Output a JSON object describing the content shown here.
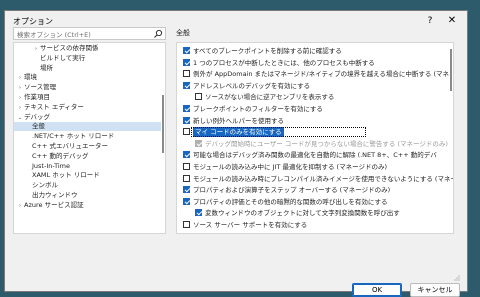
{
  "window": {
    "title": "オプション",
    "help_glyph": "?",
    "close_glyph": "✕"
  },
  "search": {
    "placeholder": "検索オプション (Ctrl+E)"
  },
  "tree": {
    "items": [
      {
        "label": "サービスの依存関係",
        "indent": 2,
        "chevron": "›"
      },
      {
        "label": "ビルドして実行",
        "indent": 2,
        "chevron": ""
      },
      {
        "label": "場所",
        "indent": 2,
        "chevron": ""
      },
      {
        "label": "環境",
        "indent": 0,
        "chevron": "›"
      },
      {
        "label": "ソース管理",
        "indent": 0,
        "chevron": "›"
      },
      {
        "label": "作業項目",
        "indent": 0,
        "chevron": "›"
      },
      {
        "label": "テキスト エディター",
        "indent": 0,
        "chevron": "›"
      },
      {
        "label": "デバッグ",
        "indent": 0,
        "chevron": "⌄"
      },
      {
        "label": "全般",
        "indent": 1,
        "chevron": "",
        "selected": true
      },
      {
        "label": ".NET/C++ ホット リロード",
        "indent": 1,
        "chevron": ""
      },
      {
        "label": "C++ 式エバリュエーター",
        "indent": 1,
        "chevron": ""
      },
      {
        "label": "C++ 動的デバッグ",
        "indent": 1,
        "chevron": ""
      },
      {
        "label": "Just-In-Time",
        "indent": 1,
        "chevron": ""
      },
      {
        "label": "XAML ホット リロード",
        "indent": 1,
        "chevron": ""
      },
      {
        "label": "シンボル",
        "indent": 1,
        "chevron": ""
      },
      {
        "label": "出力ウィンドウ",
        "indent": 1,
        "chevron": ""
      },
      {
        "label": "Azure サービス認証",
        "indent": 0,
        "chevron": "›"
      }
    ]
  },
  "section": {
    "label": "全般"
  },
  "options": [
    {
      "label": "すべてのブレークポイントを削除する前に確認する",
      "checked": true,
      "indent": 0
    },
    {
      "label": "1 つのプロセスが中断したときには、他のプロセスも中断する",
      "checked": true,
      "indent": 0
    },
    {
      "label": "例外が AppDomain またはマネージド/ネイティブの境界を越える場合に中断する (マネ",
      "checked": false,
      "indent": 0
    },
    {
      "label": "アドレスレベルのデバッグを有効にする",
      "checked": true,
      "indent": 0
    },
    {
      "label": "ソースがない場合に逆アセンブリを表示する",
      "checked": false,
      "indent": 1
    },
    {
      "label": "ブレークポイントのフィルターを有効にする",
      "checked": true,
      "indent": 0
    },
    {
      "label": "新しい例外ヘルパーを使用する",
      "checked": true,
      "indent": 0
    },
    {
      "label": "マイ コードのみを有効にする",
      "checked": false,
      "indent": 0,
      "highlight": true
    },
    {
      "label": "デバッグ開始時にユーザー コードが見つからない場合に警告する (マネージドのみ)",
      "checked": true,
      "indent": 1,
      "disabled": true
    },
    {
      "label": "可能な場合はデバッグ済み関数の最適化を自動的に解除 (.NET 8+、C++ 動的デバ",
      "checked": true,
      "indent": 0
    },
    {
      "label": "モジュールの読み込み中に JIT 最適化を抑制する (マネージドのみ)",
      "checked": false,
      "indent": 0
    },
    {
      "label": "モジュールの読み込み時にプレコンパイル済みイメージを使用できないようにする (マネージ",
      "checked": false,
      "indent": 0
    },
    {
      "label": "プロパティおよび演算子をステップ オーバーする (マネージドのみ)",
      "checked": true,
      "indent": 0
    },
    {
      "label": "プロパティの評価とその他の暗黙的な関数の呼び出しを有効にする",
      "checked": true,
      "indent": 0
    },
    {
      "label": "変数ウィンドウのオブジェクトに対して文字列変換関数を呼び出す",
      "checked": true,
      "indent": 1
    },
    {
      "label": "ソース サーバー サポートを有効にする",
      "checked": false,
      "indent": 0
    }
  ],
  "buttons": {
    "ok": "OK",
    "cancel": "キャンセル"
  },
  "colors": {
    "accent": "#1766c0",
    "selection": "#cfe1f3",
    "background": "#2e5b6b"
  }
}
